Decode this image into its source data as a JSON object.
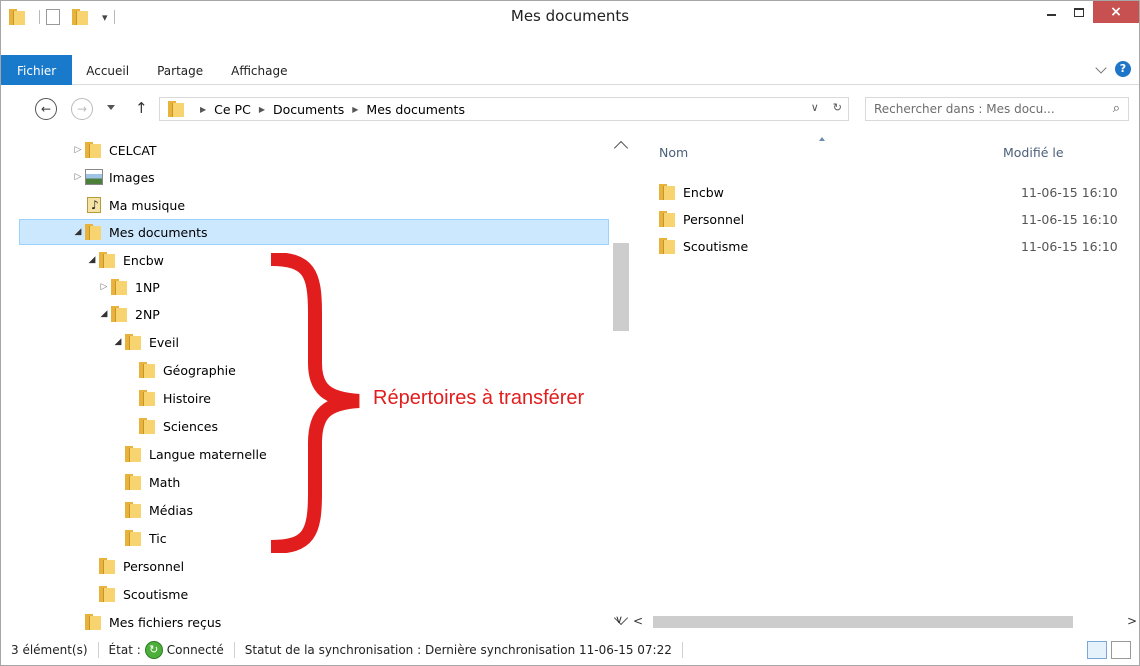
{
  "window": {
    "title": "Mes documents",
    "close_glyph": "×"
  },
  "ribbon": {
    "tabs": [
      {
        "label": "Fichier",
        "active": true
      },
      {
        "label": "Accueil"
      },
      {
        "label": "Partage"
      },
      {
        "label": "Affichage"
      }
    ],
    "help_glyph": "?"
  },
  "address_bar": {
    "crumbs": [
      "Ce PC",
      "Documents",
      "Mes documents"
    ],
    "refresh_glyph": "↻",
    "dropdown_glyph": "∨"
  },
  "search": {
    "placeholder": "Rechercher dans : Mes docu...",
    "icon": "⌕"
  },
  "tree": [
    {
      "label": "CELCAT",
      "expander": "▷",
      "icon": "folder"
    },
    {
      "label": "Images",
      "expander": "▷",
      "icon": "image"
    },
    {
      "label": "Ma musique",
      "expander": "",
      "icon": "music"
    },
    {
      "label": "Mes documents",
      "expander": "◢",
      "icon": "folder",
      "selected": true
    },
    {
      "label": "Encbw",
      "expander": "◢",
      "icon": "folder"
    },
    {
      "label": "1NP",
      "expander": "▷",
      "icon": "folder"
    },
    {
      "label": "2NP",
      "expander": "◢",
      "icon": "folder"
    },
    {
      "label": "Eveil",
      "expander": "◢",
      "icon": "folder"
    },
    {
      "label": "Géographie",
      "expander": "",
      "icon": "folder"
    },
    {
      "label": "Histoire",
      "expander": "",
      "icon": "folder"
    },
    {
      "label": "Sciences",
      "expander": "",
      "icon": "folder"
    },
    {
      "label": "Langue maternelle",
      "expander": "",
      "icon": "folder"
    },
    {
      "label": "Math",
      "expander": "",
      "icon": "folder"
    },
    {
      "label": "Médias",
      "expander": "",
      "icon": "folder"
    },
    {
      "label": "Tic",
      "expander": "",
      "icon": "folder"
    },
    {
      "label": "Personnel",
      "expander": "",
      "icon": "folder"
    },
    {
      "label": "Scoutisme",
      "expander": "",
      "icon": "folder"
    },
    {
      "label": "Mes fichiers reçus",
      "expander": "",
      "icon": "folder"
    }
  ],
  "file_list": {
    "columns": {
      "name": "Nom",
      "modified": "Modifié le"
    },
    "rows": [
      {
        "name": "Encbw",
        "modified": "11-06-15 16:10"
      },
      {
        "name": "Personnel",
        "modified": "11-06-15 16:10"
      },
      {
        "name": "Scoutisme",
        "modified": "11-06-15 16:10"
      }
    ]
  },
  "status_bar": {
    "count": "3 élément(s)",
    "state_label": "État :",
    "state_value": "Connecté",
    "sync": "Statut de la synchronisation : Dernière synchronisation 11-06-15 07:22"
  },
  "annotation": {
    "text": "Répertoires à transférer",
    "color": "#e21d1d"
  },
  "colors": {
    "accent": "#1979ca",
    "selection": "#cce8ff",
    "close_button": "#c75050"
  }
}
